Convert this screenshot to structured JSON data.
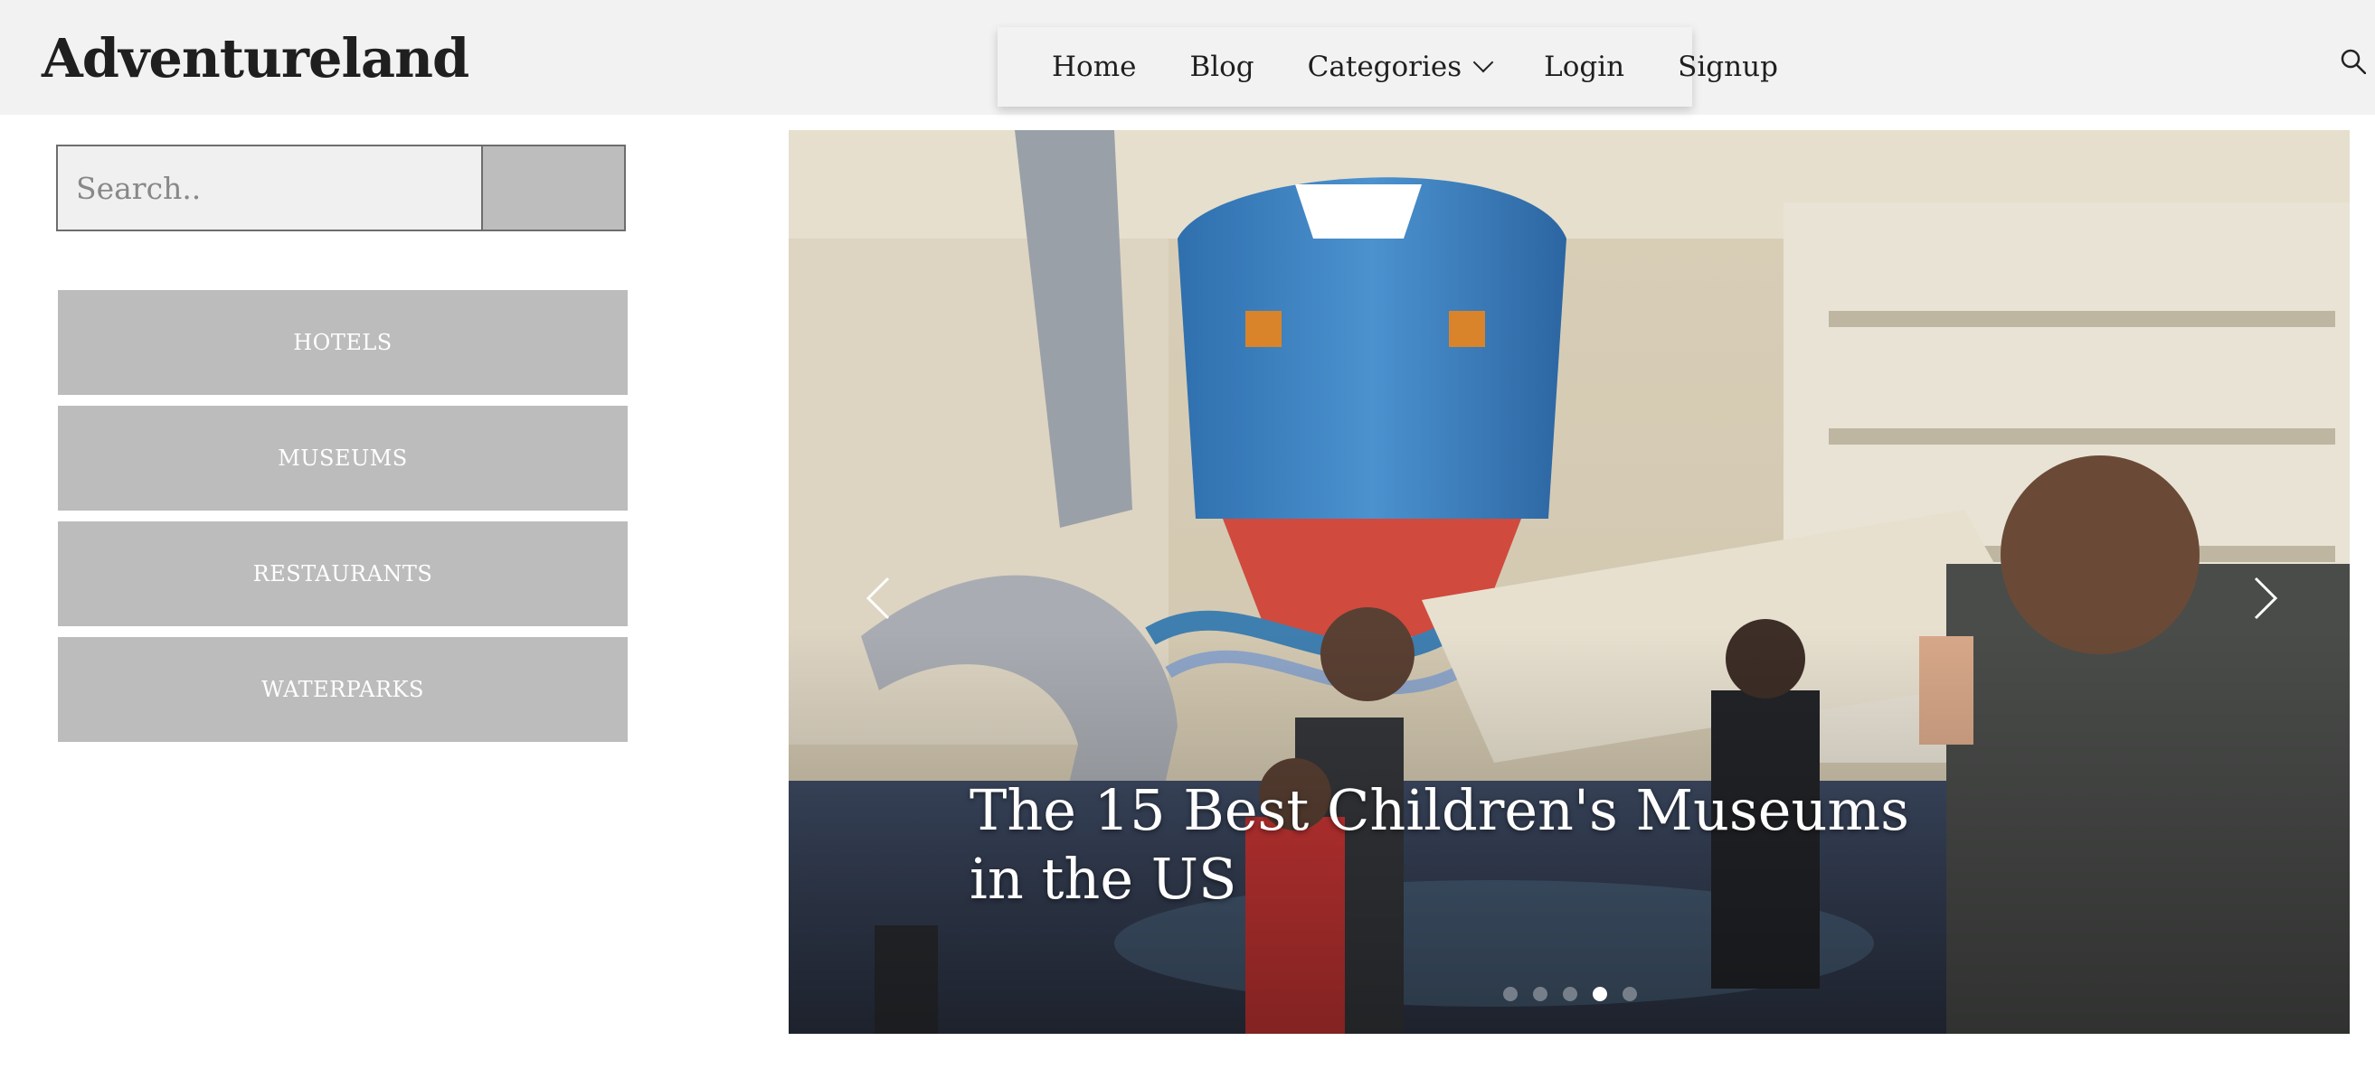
{
  "header": {
    "brand": "Adventureland",
    "nav": [
      {
        "label": "Home"
      },
      {
        "label": "Blog"
      },
      {
        "label": "Categories",
        "has_dropdown": true
      },
      {
        "label": "Login"
      },
      {
        "label": "Signup"
      }
    ],
    "search_icon": "search-icon"
  },
  "sidebar": {
    "search_placeholder": "Search..",
    "categories": [
      "HOTELS",
      "MUSEUMS",
      "RESTAURANTS",
      "WATERPARKS"
    ]
  },
  "carousel": {
    "caption": "The 15 Best Children's Museums in the US",
    "slide_count": 5,
    "active_index": 3
  },
  "colors": {
    "header_bg": "#f2f2f2",
    "category_button_bg": "#bcbcbc",
    "category_text": "#ffffff"
  }
}
